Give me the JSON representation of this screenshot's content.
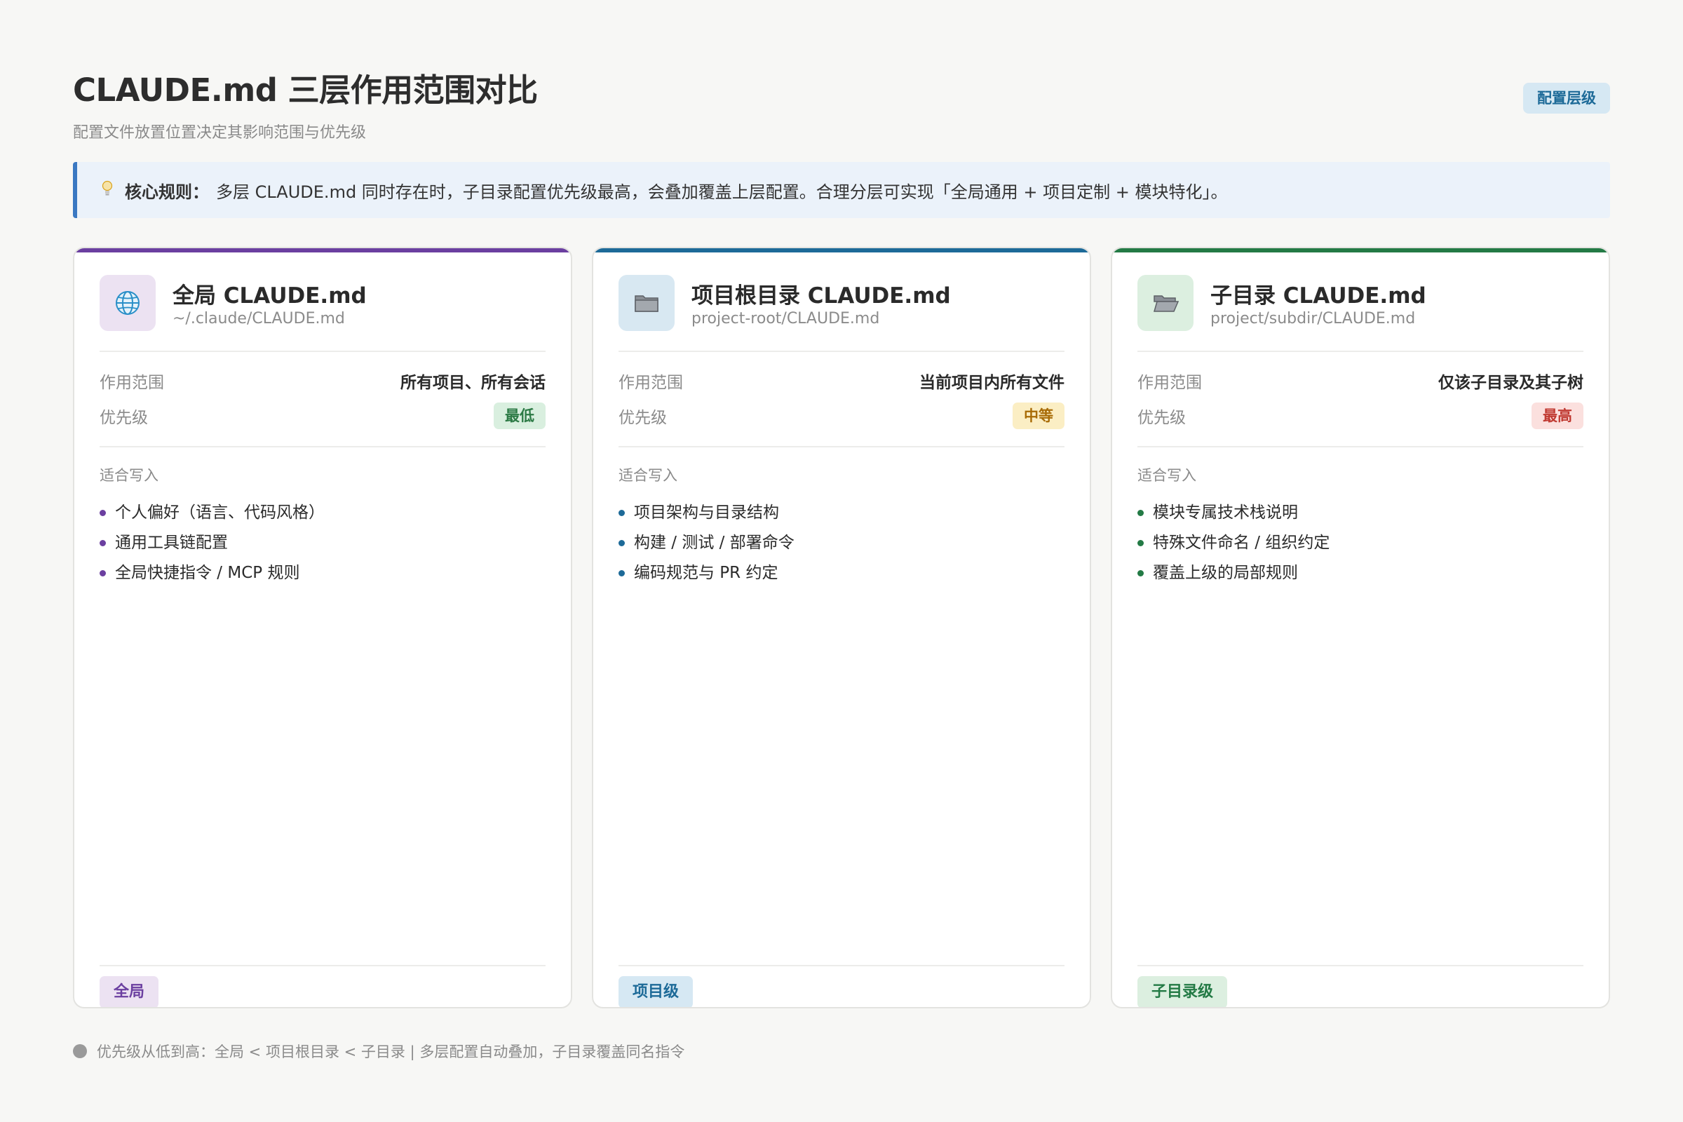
{
  "header": {
    "title": "CLAUDE.md 三层作用范围对比",
    "subtitle": "配置文件放置位置决定其影响范围与优先级",
    "badge": "配置层级"
  },
  "rule": {
    "icon": "lightbulb-icon",
    "label": "核心规则：",
    "text": "多层 CLAUDE.md 同时存在时，子目录配置优先级最高，会叠加覆盖上层配置。合理分层可实现「全局通用 + 项目定制 + 模块特化」。"
  },
  "cards": [
    {
      "accent": "#6b3fa0",
      "icon": "globe-icon",
      "icon_bg": "#ece2f2",
      "title": "全局 CLAUDE.md",
      "path": "~/.claude/CLAUDE.md",
      "scope_label": "作用范围",
      "scope_value": "所有项目、所有会话",
      "priority_label": "优先级",
      "priority_value": "最低",
      "priority_bg": "#d9efdf",
      "priority_color": "#2c7a45",
      "suit_label": "适合写入",
      "items": [
        "个人偏好（语言、代码风格）",
        "通用工具链配置",
        "全局快捷指令 / MCP 规则"
      ],
      "footer_tag": "全局",
      "footer_bg": "#ece2f2",
      "footer_color": "#6b3fa0"
    },
    {
      "accent": "#1d6a98",
      "icon": "folder-icon",
      "icon_bg": "#d8e8f2",
      "title": "项目根目录 CLAUDE.md",
      "path": "project-root/CLAUDE.md",
      "scope_label": "作用范围",
      "scope_value": "当前项目内所有文件",
      "priority_label": "优先级",
      "priority_value": "中等",
      "priority_bg": "#fbeec4",
      "priority_color": "#a86b06",
      "suit_label": "适合写入",
      "items": [
        "项目架构与目录结构",
        "构建 / 测试 / 部署命令",
        "编码规范与 PR 约定"
      ],
      "footer_tag": "项目级",
      "footer_bg": "#d6e8f3",
      "footer_color": "#1d6a98"
    },
    {
      "accent": "#237a45",
      "icon": "open-folder-icon",
      "icon_bg": "#dcefe0",
      "title": "子目录 CLAUDE.md",
      "path": "project/subdir/CLAUDE.md",
      "scope_label": "作用范围",
      "scope_value": "仅该子目录及其子树",
      "priority_label": "优先级",
      "priority_value": "最高",
      "priority_bg": "#fbe0de",
      "priority_color": "#c03a32",
      "suit_label": "适合写入",
      "items": [
        "模块专属技术栈说明",
        "特殊文件命名 / 组织约定",
        "覆盖上级的局部规则"
      ],
      "footer_tag": "子目录级",
      "footer_bg": "#dcefe0",
      "footer_color": "#237a45"
    }
  ],
  "footer": {
    "text": "优先级从低到高：全局 < 项目根目录 < 子目录 | 多层配置自动叠加，子目录覆盖同名指令"
  }
}
